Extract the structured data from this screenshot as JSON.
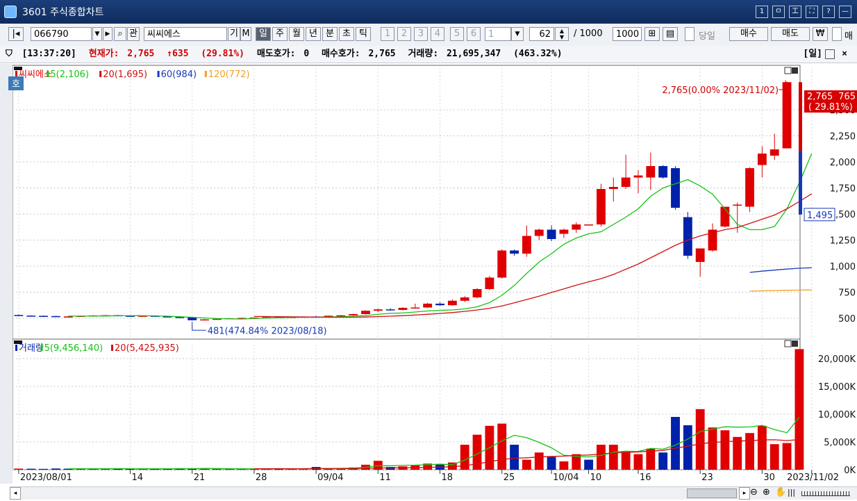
{
  "window": {
    "title": "3601 주식종합차트",
    "buttons": [
      "1",
      "ㅁ",
      "工",
      "⛶",
      "?",
      "—"
    ]
  },
  "toolbar": {
    "code": "066790",
    "name": "씨씨에스",
    "gi": "기",
    "m": "M",
    "gwan": "관",
    "periods": [
      "일",
      "주",
      "월",
      "년",
      "분",
      "초",
      "틱"
    ],
    "active_period": "일",
    "numbers": [
      "1",
      "2",
      "3",
      "4",
      "5",
      "6"
    ],
    "period_select": "1",
    "count": "62",
    "total_label": "/ 1000",
    "total_value": "1000",
    "today_label": "당일",
    "buy": "매수",
    "sell": "매도",
    "won": "₩",
    "extra": "매"
  },
  "info": {
    "time": "[13:37:20]",
    "price_label": "현재가:",
    "price": "2,765",
    "change": "↑635",
    "change_pct": "(29.81%)",
    "ask_label": "매도호가:",
    "ask": "0",
    "bid_label": "매수호가:",
    "bid": "2,765",
    "vol_label": "거래량:",
    "volume": "21,695,347",
    "vol_pct": "(463.32%)",
    "period_tag": "[일]"
  },
  "chart_data": [
    {
      "type": "candlestick",
      "panel": "price",
      "legend": [
        "씨씨에스",
        "5(2,106)",
        "20(1,695)",
        "60(984)",
        "120(772)"
      ],
      "ylim": [
        300,
        2900
      ],
      "y_ticks": [
        500,
        750,
        1000,
        1250,
        1500,
        1750,
        2000,
        2250,
        2500
      ],
      "y_tick_labels": [
        "500",
        "750",
        "1,000",
        "1,250",
        "1,500",
        "1,750",
        "2,000",
        "2,250",
        "2,500"
      ],
      "x_labels": [
        "2023/08/01",
        "14",
        "21",
        "28",
        "09/04",
        "11",
        "18",
        "25",
        "10/04",
        "10",
        "16",
        "23",
        "30",
        "2023/11/02"
      ],
      "x_label_idx": [
        0,
        9,
        14,
        19,
        24,
        29,
        34,
        39,
        43,
        46,
        50,
        55,
        60,
        64
      ],
      "candles": [
        [
          531,
          536,
          519,
          525
        ],
        [
          525,
          528,
          519,
          523
        ],
        [
          523,
          527,
          518,
          521
        ],
        [
          521,
          524,
          512,
          515
        ],
        [
          515,
          519,
          510,
          517
        ],
        [
          517,
          526,
          514,
          523
        ],
        [
          523,
          530,
          519,
          527
        ],
        [
          527,
          532,
          522,
          529
        ],
        [
          529,
          533,
          520,
          524
        ],
        [
          524,
          528,
          518,
          521
        ],
        [
          521,
          527,
          515,
          524
        ],
        [
          524,
          528,
          516,
          518
        ],
        [
          518,
          522,
          510,
          512
        ],
        [
          512,
          518,
          500,
          510
        ],
        [
          510,
          514,
          478,
          481
        ],
        [
          481,
          492,
          478,
          489
        ],
        [
          489,
          498,
          485,
          495
        ],
        [
          495,
          503,
          490,
          500
        ],
        [
          500,
          507,
          495,
          503
        ],
        [
          503,
          509,
          497,
          506
        ],
        [
          506,
          513,
          502,
          511
        ],
        [
          511,
          516,
          504,
          508
        ],
        [
          508,
          514,
          503,
          512
        ],
        [
          512,
          519,
          508,
          516
        ],
        [
          516,
          522,
          510,
          514
        ],
        [
          514,
          526,
          512,
          524
        ],
        [
          524,
          532,
          520,
          528
        ],
        [
          528,
          545,
          524,
          540
        ],
        [
          540,
          576,
          536,
          572
        ],
        [
          572,
          592,
          560,
          585
        ],
        [
          585,
          596,
          575,
          580
        ],
        [
          580,
          605,
          574,
          600
        ],
        [
          600,
          640,
          595,
          603
        ],
        [
          603,
          648,
          598,
          640
        ],
        [
          640,
          655,
          620,
          625
        ],
        [
          625,
          680,
          620,
          668
        ],
        [
          668,
          712,
          655,
          700
        ],
        [
          700,
          790,
          690,
          780
        ],
        [
          780,
          905,
          770,
          890
        ],
        [
          890,
          1160,
          880,
          1150
        ],
        [
          1150,
          1160,
          1100,
          1120
        ],
        [
          1120,
          1390,
          1090,
          1290
        ],
        [
          1290,
          1360,
          1250,
          1350
        ],
        [
          1350,
          1390,
          1240,
          1260
        ],
        [
          1310,
          1360,
          1270,
          1350
        ],
        [
          1350,
          1420,
          1320,
          1400
        ],
        [
          1400,
          1390,
          1390,
          1400
        ],
        [
          1400,
          1790,
          1380,
          1740
        ],
        [
          1740,
          1850,
          1620,
          1760
        ],
        [
          1760,
          2070,
          1740,
          1850
        ],
        [
          1850,
          1920,
          1700,
          1870
        ],
        [
          1850,
          2090,
          1730,
          1960
        ],
        [
          1960,
          1970,
          1840,
          1850
        ],
        [
          1940,
          1960,
          1540,
          1560
        ],
        [
          1470,
          1520,
          1070,
          1100
        ],
        [
          1040,
          1100,
          900,
          1170
        ],
        [
          1150,
          1410,
          1140,
          1350
        ],
        [
          1380,
          1550,
          1370,
          1570
        ],
        [
          1580,
          1610,
          1320,
          1590
        ],
        [
          1570,
          1950,
          1520,
          1940
        ],
        [
          1970,
          2150,
          1850,
          2080
        ],
        [
          2060,
          2270,
          2020,
          2120
        ],
        [
          2130,
          2770,
          2130,
          2765
        ]
      ],
      "ma": [
        {
          "name": "5",
          "values": [
            null,
            null,
            null,
            null,
            521,
            521,
            521,
            522,
            524,
            525,
            525,
            523,
            520,
            515,
            509,
            503,
            497,
            495,
            493,
            497,
            502,
            505,
            507,
            510,
            511,
            512,
            515,
            519,
            526,
            537,
            547,
            551,
            560,
            570,
            576,
            580,
            590,
            610,
            650,
            720,
            815,
            930,
            1040,
            1120,
            1210,
            1270,
            1310,
            1330,
            1400,
            1470,
            1550,
            1670,
            1750,
            1790,
            1830,
            1770,
            1690,
            1550,
            1400,
            1350,
            1350,
            1380,
            1550,
            1800,
            2080
          ]
        },
        {
          "name": "20",
          "values": [
            null,
            null,
            null,
            null,
            null,
            null,
            null,
            null,
            null,
            null,
            null,
            null,
            null,
            null,
            null,
            null,
            null,
            null,
            null,
            517,
            516,
            515,
            514,
            512,
            511,
            510,
            510,
            510,
            512,
            516,
            520,
            525,
            531,
            538,
            546,
            555,
            566,
            579,
            596,
            617,
            648,
            680,
            712,
            747,
            782,
            817,
            849,
            880,
            920,
            970,
            1020,
            1080,
            1140,
            1200,
            1250,
            1290,
            1320,
            1350,
            1370,
            1410,
            1450,
            1490,
            1550,
            1620,
            1695
          ]
        },
        {
          "name": "60",
          "values": [
            null,
            null,
            null,
            null,
            null,
            null,
            null,
            null,
            null,
            null,
            null,
            null,
            null,
            null,
            null,
            null,
            null,
            null,
            null,
            null,
            null,
            null,
            null,
            null,
            null,
            null,
            null,
            null,
            null,
            null,
            null,
            null,
            null,
            null,
            null,
            null,
            null,
            null,
            null,
            null,
            null,
            null,
            null,
            null,
            null,
            null,
            null,
            null,
            null,
            null,
            null,
            null,
            null,
            null,
            null,
            null,
            null,
            null,
            null,
            940,
            952,
            962,
            972,
            980,
            984
          ]
        },
        {
          "name": "120",
          "values": [
            null,
            null,
            null,
            null,
            null,
            null,
            null,
            null,
            null,
            null,
            null,
            null,
            null,
            null,
            null,
            null,
            null,
            null,
            null,
            null,
            null,
            null,
            null,
            null,
            null,
            null,
            null,
            null,
            null,
            null,
            null,
            null,
            null,
            null,
            null,
            null,
            null,
            null,
            null,
            null,
            null,
            null,
            null,
            null,
            null,
            null,
            null,
            null,
            null,
            null,
            null,
            null,
            null,
            null,
            null,
            null,
            null,
            null,
            null,
            760,
            763,
            766,
            768,
            770,
            772
          ]
        }
      ],
      "annotations": {
        "max_label": "2,765(0.00% 2023/11/02)",
        "min_label": "481(474.84% 2023/08/18)",
        "current_price": "2,765",
        "current_price_right": "765",
        "current_change": "( 29.81%)",
        "prev_close": "1,495"
      },
      "badge": "호"
    },
    {
      "type": "bar",
      "panel": "volume",
      "legend": [
        "거래량",
        "5(9,456,140)",
        "20(5,425,935)"
      ],
      "ylim": [
        0,
        22500
      ],
      "y_ticks": [
        0,
        5000,
        10000,
        15000,
        20000
      ],
      "y_tick_labels": [
        "0K",
        "5,000K",
        "10,000K",
        "15,000K",
        "20,000K"
      ],
      "unit": "K",
      "values": [
        200,
        180,
        150,
        220,
        190,
        210,
        160,
        170,
        230,
        150,
        140,
        180,
        200,
        260,
        240,
        180,
        170,
        150,
        160,
        200,
        190,
        170,
        160,
        180,
        500,
        200,
        180,
        400,
        900,
        1600,
        500,
        600,
        800,
        1100,
        1000,
        1300,
        4500,
        6300,
        7900,
        8300,
        4500,
        1800,
        3100,
        2300,
        1500,
        2800,
        1800,
        4500,
        4500,
        3300,
        2800,
        3800,
        3100,
        9500,
        8000,
        10900,
        7600,
        7100,
        5900,
        6600,
        7900,
        4600,
        4800,
        21700
      ],
      "up": [
        1,
        0,
        0,
        0,
        0,
        1,
        1,
        1,
        0,
        0,
        1,
        0,
        0,
        0,
        0,
        1,
        1,
        1,
        1,
        1,
        1,
        0,
        1,
        1,
        0,
        1,
        1,
        1,
        1,
        1,
        0,
        1,
        1,
        1,
        0,
        1,
        1,
        1,
        1,
        1,
        0,
        1,
        1,
        0,
        1,
        1,
        0,
        1,
        1,
        1,
        1,
        1,
        0,
        0,
        0,
        1,
        1,
        1,
        1,
        1,
        1,
        1,
        1,
        1
      ],
      "ma": [
        {
          "name": "5",
          "values": [
            null,
            null,
            null,
            null,
            188,
            184,
            188,
            192,
            196,
            184,
            170,
            174,
            176,
            186,
            204,
            220,
            210,
            192,
            180,
            172,
            178,
            182,
            176,
            176,
            240,
            242,
            244,
            288,
            436,
            720,
            716,
            806,
            820,
            900,
            1000,
            900,
            1740,
            2840,
            3980,
            5200,
            6200,
            5760,
            4920,
            3940,
            2600,
            2400,
            2300,
            2580,
            3180,
            3340,
            3280,
            3840,
            3700,
            4400,
            5520,
            6880,
            7300,
            7720,
            7660,
            7700,
            7980,
            7220,
            6660,
            9456
          ]
        },
        {
          "name": "20",
          "values": [
            null,
            null,
            null,
            null,
            null,
            null,
            null,
            null,
            null,
            null,
            null,
            null,
            null,
            null,
            null,
            null,
            null,
            null,
            null,
            190,
            190,
            189,
            188,
            186,
            200,
            200,
            201,
            212,
            247,
            315,
            332,
            354,
            386,
            431,
            471,
            527,
            742,
            1050,
            1436,
            1846,
            2061,
            2144,
            2290,
            2400,
            2450,
            2580,
            2650,
            2830,
            3010,
            3110,
            3210,
            3350,
            3470,
            3880,
            4240,
            4670,
            4900,
            5050,
            5180,
            5210,
            5380,
            5390,
            5250,
            5426
          ]
        }
      ]
    }
  ],
  "colors": {
    "up": "#e00000",
    "down": "#0022aa",
    "ma5": "#17c117",
    "ma20": "#d01010",
    "ma60": "#1838b8",
    "ma120": "#f0a020"
  }
}
